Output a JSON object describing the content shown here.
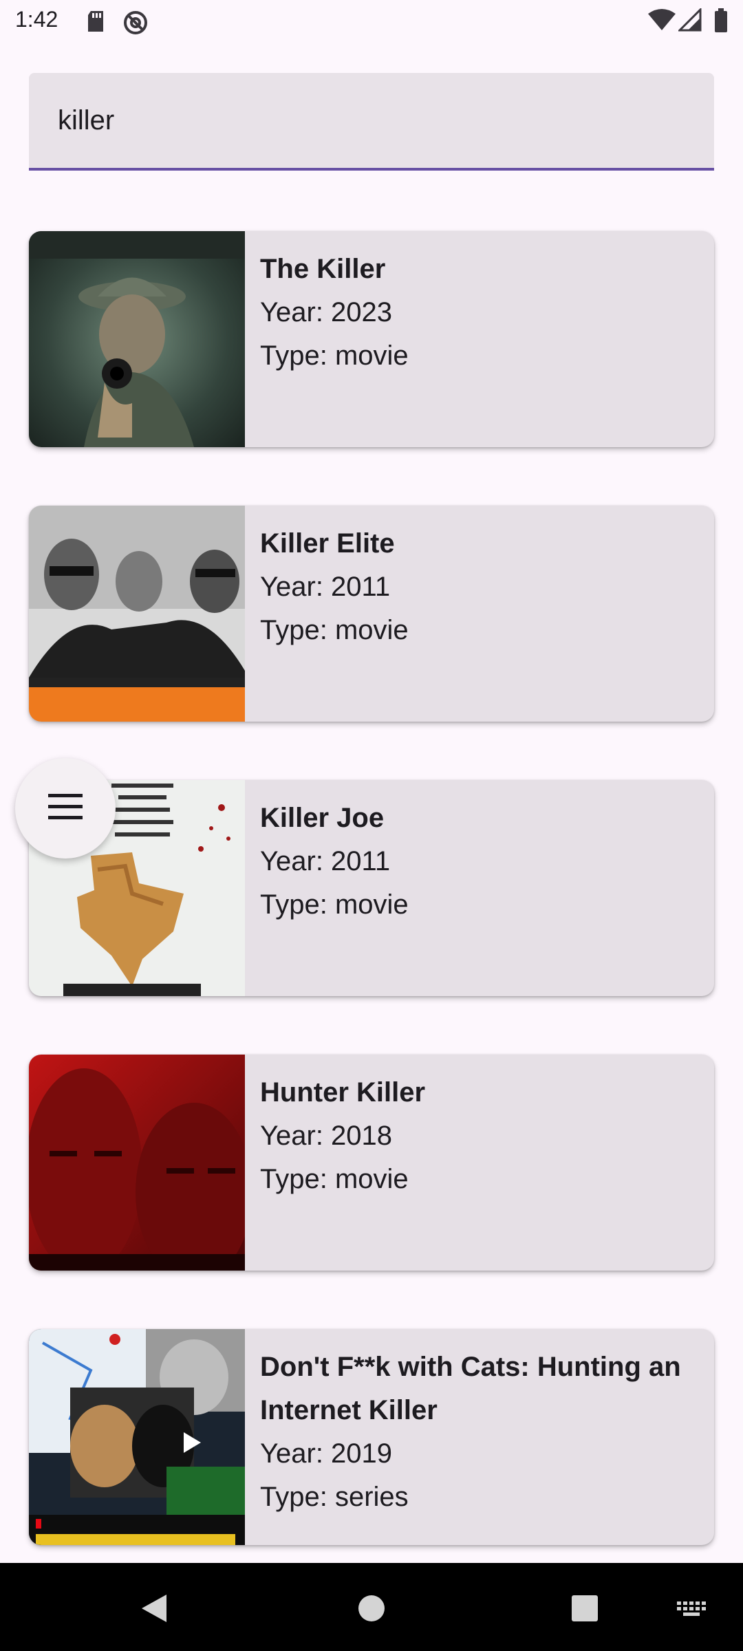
{
  "status_bar": {
    "time": "1:42",
    "icons": [
      "sd-card-icon",
      "do-not-disturb-icon",
      "wifi-icon",
      "signal-icon",
      "battery-icon"
    ]
  },
  "search": {
    "value": "killer",
    "accent_color": "#6750a4"
  },
  "results": [
    {
      "title": "The Killer",
      "year": "Year: 2023",
      "type": "Type: movie"
    },
    {
      "title": "Killer Elite",
      "year": "Year: 2011",
      "type": "Type: movie"
    },
    {
      "title": "Killer Joe",
      "year": "Year: 2011",
      "type": "Type: movie"
    },
    {
      "title": "Hunter Killer",
      "year": "Year: 2018",
      "type": "Type: movie"
    },
    {
      "title": "Don't F**k with Cats: Hunting an Internet Killer",
      "year": "Year: 2019",
      "type": "Type: series"
    }
  ],
  "fab": {
    "icon": "menu-icon"
  },
  "nav_bar": {
    "icons": [
      "back-icon",
      "home-icon",
      "recents-icon",
      "keyboard-icon"
    ]
  }
}
